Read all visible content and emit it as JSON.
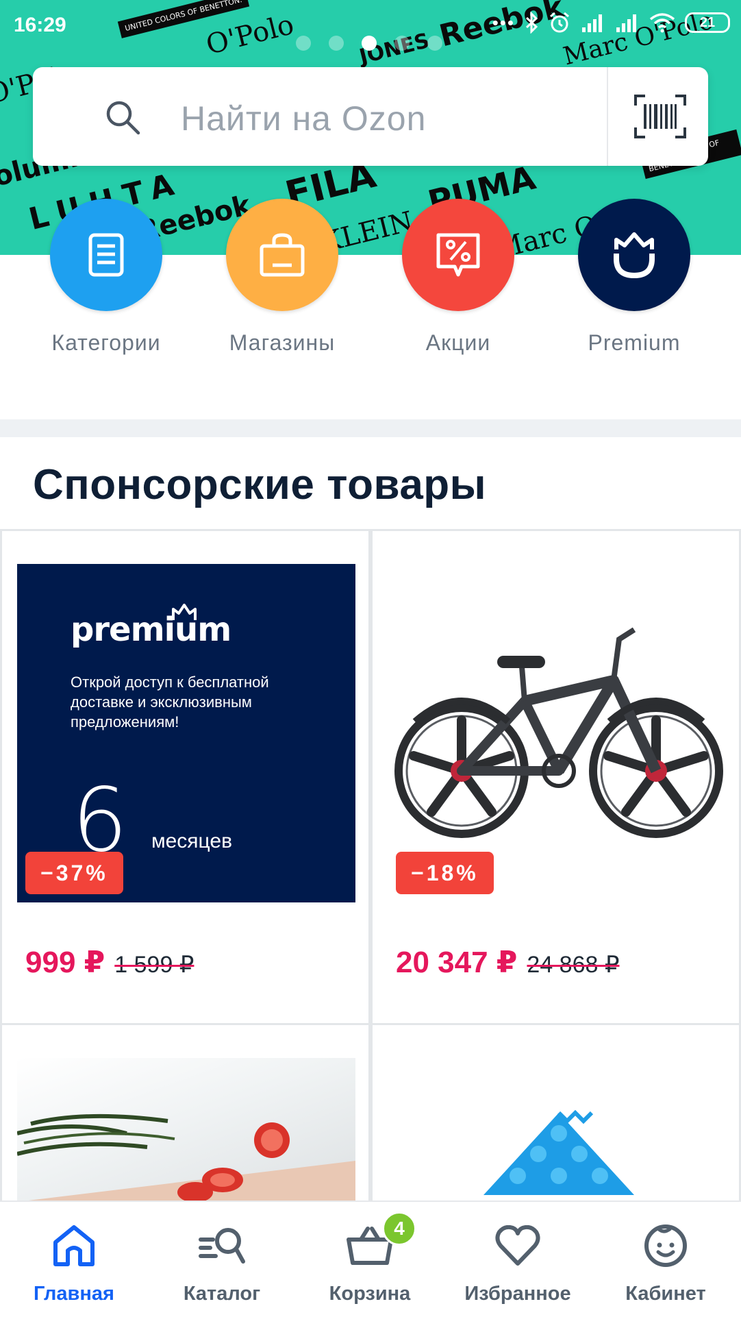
{
  "status_bar": {
    "time": "16:29",
    "battery": "21",
    "indicator_dots": "•••"
  },
  "hero": {
    "background_color": "#26cdaa",
    "brand_watermarks": [
      "Reebok",
      "O'Polo",
      "JONES",
      "PUMA",
      "FILA",
      "LUHTA",
      "Marc O'Polo",
      "UNITED COLORS OF BENETTON.",
      "KLEIN",
      "Columbia"
    ],
    "pager": {
      "count": 5,
      "active_index": 2
    }
  },
  "search": {
    "placeholder": "Найти на Ozon",
    "icon": "search-icon",
    "scan_icon": "barcode-scan-icon"
  },
  "quick_links": [
    {
      "label": "Категории",
      "icon": "categories-icon",
      "color": "#1ea0f0"
    },
    {
      "label": "Магазины",
      "icon": "shopping-bag-icon",
      "color": "#feaf44"
    },
    {
      "label": "Акции",
      "icon": "discount-tag-icon",
      "color": "#f4473d"
    },
    {
      "label": "Premium",
      "icon": "premium-crown-icon",
      "color": "#001a4c"
    }
  ],
  "section": {
    "title": "Спонсорские товары"
  },
  "products": [
    {
      "image": "premium-banner",
      "banner_logo": "premium",
      "banner_text": "Открой доступ к бесплатной доставке и эксклюзивным предложениям!",
      "banner_number": "6",
      "banner_unit": "месяцев",
      "discount": "−37%",
      "price": "999 ₽",
      "old_price": "1 599 ₽"
    },
    {
      "image": "bicycle-photo",
      "discount": "−18%",
      "price": "20 347 ₽",
      "old_price": "24 868 ₽"
    },
    {
      "image": "food-board-photo"
    },
    {
      "image": "massage-mat-photo"
    }
  ],
  "bottom_nav": {
    "items": [
      {
        "label": "Главная",
        "icon": "home-icon",
        "active": true
      },
      {
        "label": "Каталог",
        "icon": "catalog-search-icon",
        "active": false
      },
      {
        "label": "Корзина",
        "icon": "cart-basket-icon",
        "active": false,
        "badge": "4"
      },
      {
        "label": "Избранное",
        "icon": "heart-icon",
        "active": false
      },
      {
        "label": "Кабинет",
        "icon": "profile-face-icon",
        "active": false
      }
    ],
    "active_color": "#1362f5",
    "badge_color": "#7bc62e"
  },
  "colors": {
    "price": "#e5175c",
    "discount_badge": "#f2433a",
    "title": "#0f1f35"
  }
}
